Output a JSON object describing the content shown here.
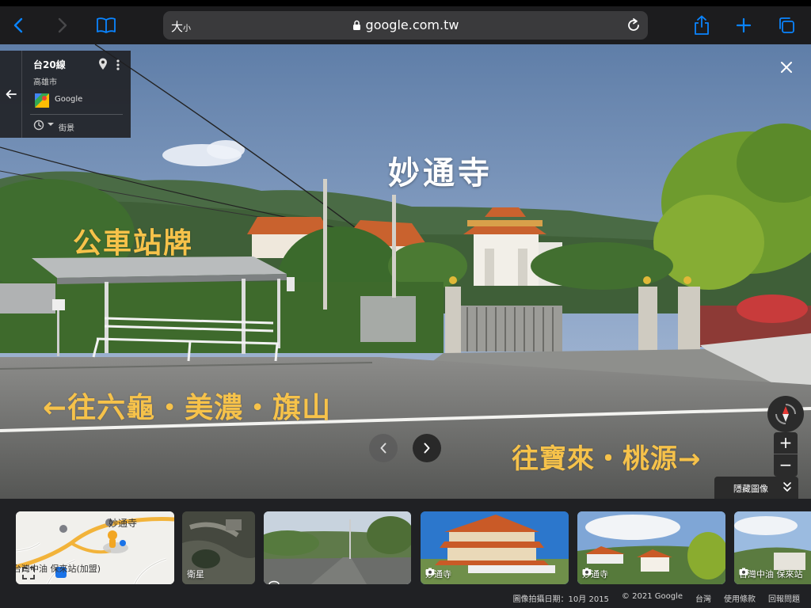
{
  "browser": {
    "url_size_label": "大",
    "url_size_small": "小",
    "url": "google.com.tw",
    "icons": [
      "back-icon",
      "forward-icon",
      "bookmarks-icon",
      "share-icon",
      "new-tab-icon",
      "tabs-icon",
      "lock-icon",
      "reload-icon"
    ]
  },
  "info_card": {
    "title": "台20線",
    "subtitle": "高雄市",
    "provider": "Google",
    "mode": "街景"
  },
  "overlays": {
    "temple": "妙通寺",
    "bus_stop": "公車站牌",
    "left_direction": "←往六龜・美濃・旗山",
    "right_direction": "往寶來・桃源→"
  },
  "controls": {
    "zoom_in": "+",
    "zoom_out": "−",
    "hide_images": "隱藏圖像"
  },
  "thumbnails": [
    {
      "kind": "map",
      "labels": [
        "妙通寺",
        "台灣中油 保來站(加盟)"
      ]
    },
    {
      "kind": "satellite",
      "label": "衛星"
    },
    {
      "kind": "street",
      "label": ""
    },
    {
      "kind": "photo",
      "label": "妙通寺"
    },
    {
      "kind": "photo",
      "label": "妙通寺"
    },
    {
      "kind": "photo",
      "label": "台灣中油 保來站"
    }
  ],
  "footer": {
    "date": "圖像拍攝日期：10月 2015",
    "copyright": "© 2021 Google",
    "region": "台灣",
    "terms": "使用條款",
    "report": "回報問題"
  },
  "colors": {
    "toolbar": "#1c1c1e",
    "accent": "#0a84ff",
    "overlay_yellow": "#f6c24a"
  }
}
